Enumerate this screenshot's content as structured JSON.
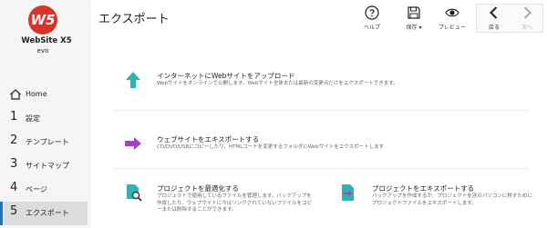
{
  "app": {
    "logo_mark": "W5",
    "logo_name": "WebSite X5",
    "logo_sub": "evo"
  },
  "sidebar": {
    "items": [
      {
        "num": "",
        "label": "Home",
        "icon": "home-icon"
      },
      {
        "num": "1",
        "label": "設定"
      },
      {
        "num": "2",
        "label": "テンプレート"
      },
      {
        "num": "3",
        "label": "サイトマップ"
      },
      {
        "num": "4",
        "label": "ページ"
      },
      {
        "num": "5",
        "label": "エクスポート",
        "active": true
      }
    ]
  },
  "header": {
    "title": "エクスポート",
    "help_label": "ヘルプ",
    "save_label": "保存 ▾",
    "preview_label": "プレビュー",
    "back_label": "戻る",
    "next_label": "次へ"
  },
  "main": {
    "upload": {
      "title": "インターネットにWebサイトをアップロード",
      "desc": "Webサイトをオンラインで公開します。Webサイト全体または最新の変更点だけをエクスポートできます。",
      "icon": "upload-arrow-icon"
    },
    "export_site": {
      "title": "ウェブサイトをエキスポートする",
      "desc": "CD/DVD/USBにコピーしたり、HTMLコードを変更するフォルダにWebサイトをエクスポートします",
      "icon": "export-arrow-icon"
    },
    "optimize": {
      "title": "プロジェクトを最適化する",
      "desc": "プロジェクトで使用しているファイルを管理します。バックアップを作成したり、ウェブサイトに今はリンクされていないファイルをコピーまたは削除することができます。",
      "icon": "optimize-project-icon"
    },
    "export_project": {
      "title": "プロジェクトをエキスポートする",
      "desc": "バックアップを作成するか、プロジェクトを別のパソコンに移すために プロジェクトファイルをエキスポートします。",
      "icon": "export-project-icon"
    }
  },
  "colors": {
    "brand_red": "#d9342b",
    "accent_teal": "#2bb5b0",
    "accent_purple": "#a340c9",
    "active_nav": "#dcdcdc"
  }
}
